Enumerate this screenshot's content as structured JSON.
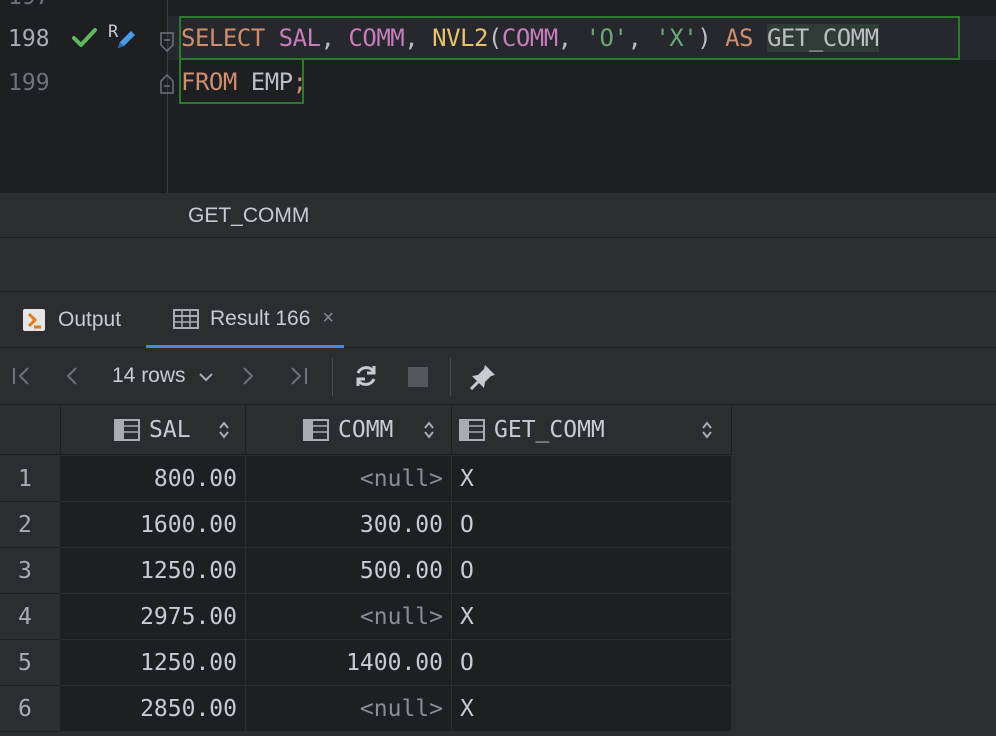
{
  "editor": {
    "prev_line_number": "197",
    "line_numbers": [
      "198",
      "199"
    ],
    "gutter_r_marker": "R",
    "line1": {
      "select": "SELECT",
      "sal": "SAL",
      "comma1": ", ",
      "comm1": "COMM",
      "comma2": ", ",
      "nvl2": "NVL2",
      "paren_open": "(",
      "comm2": "COMM",
      "comma3": ", ",
      "str_o": "'O'",
      "comma4": ", ",
      "str_x": "'X'",
      "paren_close": ")",
      "as": "AS",
      "alias": "GET_COMM"
    },
    "line2": {
      "from": "FROM",
      "table": "EMP",
      "semicolon": ";"
    }
  },
  "hint": {
    "text": "GET_COMM"
  },
  "tabs": [
    {
      "label": "Output",
      "icon": "output-icon"
    },
    {
      "label": "Result 166",
      "icon": "table-icon",
      "close": "×"
    }
  ],
  "toolbar": {
    "rows_label": "14 rows",
    "icons": [
      "first-page-icon",
      "prev-page-icon",
      "chevron-down-icon",
      "next-page-icon",
      "last-page-icon",
      "refresh-icon",
      "stop-icon",
      "pin-icon"
    ]
  },
  "grid": {
    "columns": [
      "SAL",
      "COMM",
      "GET_COMM"
    ],
    "rows": [
      {
        "num": "1",
        "sal": "800.00",
        "comm": "<null>",
        "get": "X"
      },
      {
        "num": "2",
        "sal": "1600.00",
        "comm": "300.00",
        "get": "O"
      },
      {
        "num": "3",
        "sal": "1250.00",
        "comm": "500.00",
        "get": "O"
      },
      {
        "num": "4",
        "sal": "2975.00",
        "comm": "<null>",
        "get": "X"
      },
      {
        "num": "5",
        "sal": "1250.00",
        "comm": "1400.00",
        "get": "O"
      },
      {
        "num": "6",
        "sal": "2850.00",
        "comm": "<null>",
        "get": "X"
      }
    ]
  },
  "colors": {
    "editor_bg": "#1e1f22",
    "panel_bg": "#2b2d30",
    "keyword": "#cf8e6d",
    "identifier": "#c77dbb",
    "function": "#e8c46a",
    "string": "#6aab73",
    "highlight_border": "#2c7a2c",
    "accent": "#4c84d8",
    "check": "#5fb85f"
  }
}
